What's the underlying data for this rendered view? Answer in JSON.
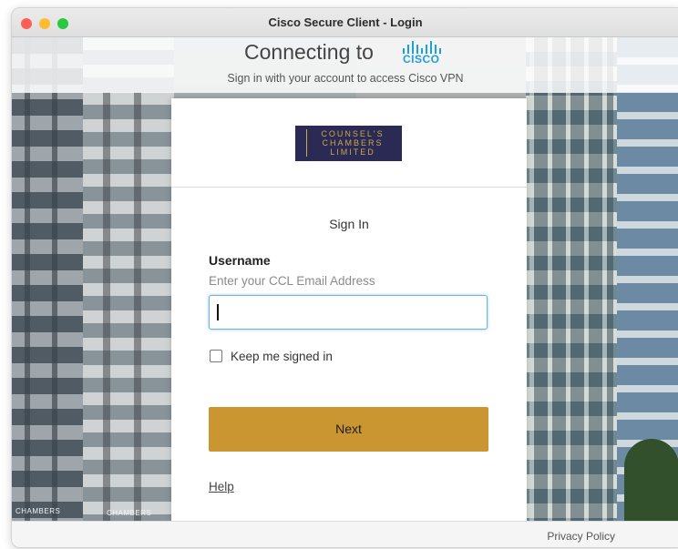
{
  "window": {
    "title": "Cisco Secure Client - Login"
  },
  "header": {
    "connecting": "Connecting to",
    "cisco_logo_text": "CISCO",
    "subtitle": "Sign in with your account to access Cisco VPN"
  },
  "background": {
    "sign_left": "CHAMBERS",
    "sign_right": "CHAMBERS"
  },
  "card": {
    "org_logo_lines": [
      "COUNSEL'S",
      "CHAMBERS",
      "LIMITED"
    ],
    "title": "Sign In",
    "username_label": "Username",
    "username_hint": "Enter your CCL Email Address",
    "username_value": "",
    "keep_signed_in_label": "Keep me signed in",
    "keep_signed_in_checked": false,
    "next_label": "Next",
    "help_label": "Help"
  },
  "footer": {
    "privacy_label": "Privacy Policy"
  },
  "colors": {
    "accent": "#c99632",
    "cisco_blue": "#1ba0d7",
    "input_focus": "#6db3e3",
    "logo_bg": "#2a2a55"
  }
}
